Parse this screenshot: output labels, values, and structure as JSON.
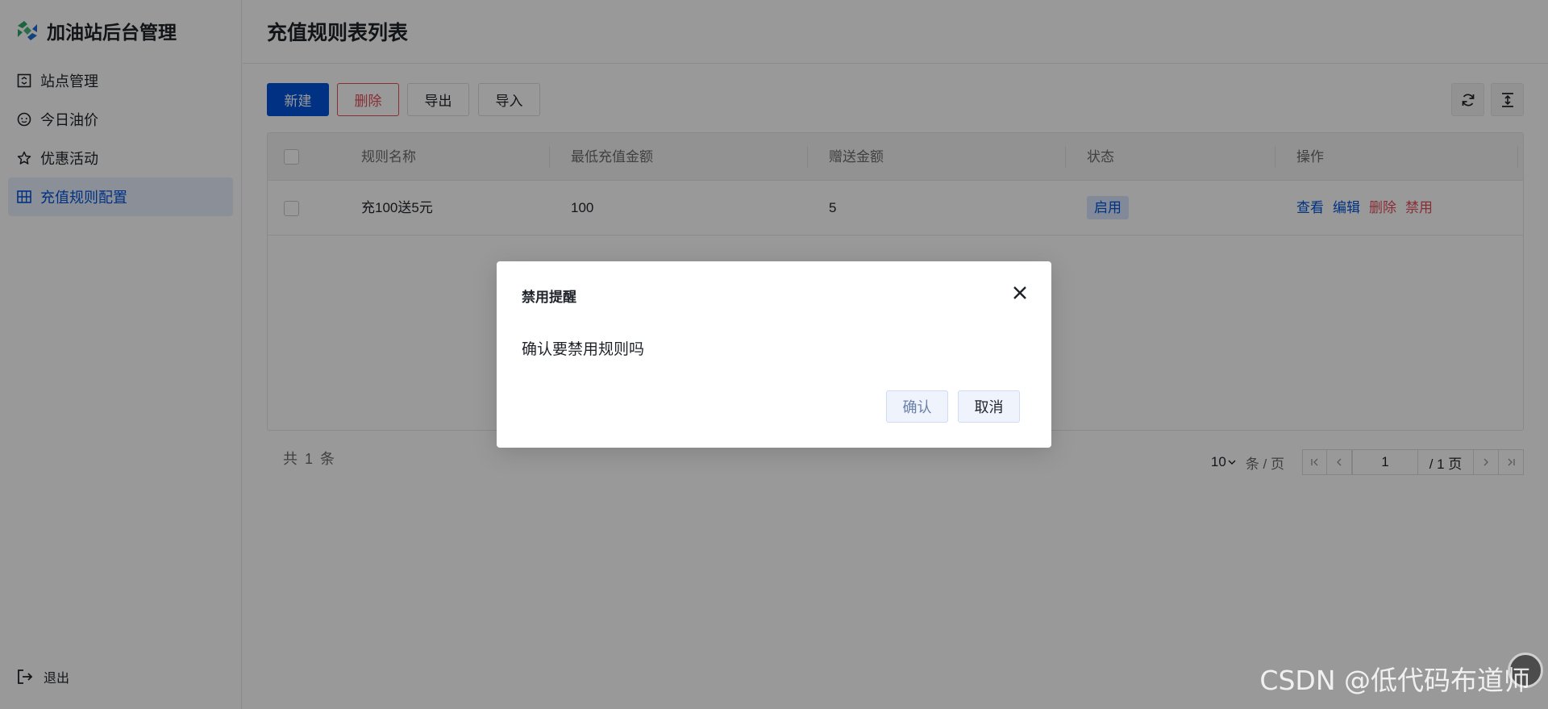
{
  "app": {
    "name": "加油站后台管理",
    "brand_colors": [
      "#2aa86b",
      "#1f6fd1"
    ]
  },
  "sidebar": {
    "items": [
      {
        "label": "站点管理",
        "icon": "building-icon",
        "active": false
      },
      {
        "label": "今日油价",
        "icon": "smile-icon",
        "active": false
      },
      {
        "label": "优惠活动",
        "icon": "star-icon",
        "active": false
      },
      {
        "label": "充值规则配置",
        "icon": "grid-icon",
        "active": true
      }
    ],
    "logout_label": "退出"
  },
  "page": {
    "title": "充值规则表列表"
  },
  "toolbar": {
    "new_label": "新建",
    "delete_label": "删除",
    "export_label": "导出",
    "import_label": "导入",
    "refresh_icon": "refresh-icon",
    "collapse_icon": "vertical-expand-icon"
  },
  "table": {
    "columns": [
      "规则名称",
      "最低充值金额",
      "赠送金额",
      "状态",
      "操作"
    ],
    "rows": [
      {
        "name": "充100送5元",
        "min_amount": "100",
        "gift_amount": "5",
        "status": "启用",
        "actions": [
          "查看",
          "编辑",
          "删除",
          "禁用"
        ]
      }
    ]
  },
  "pagination": {
    "total_text": "共 1 条",
    "page_size": "10",
    "page_size_unit": "条 / 页",
    "current_page": "1",
    "total_pages_text": "/ 1 页"
  },
  "modal": {
    "title": "禁用提醒",
    "message": "确认要禁用规则吗",
    "confirm_label": "确认",
    "cancel_label": "取消"
  },
  "watermark": {
    "text": "CSDN @低代码布道师"
  },
  "colors": {
    "primary": "#0052d9",
    "danger": "#e34d59",
    "overlay": "rgba(0,0,0,0.4)"
  }
}
